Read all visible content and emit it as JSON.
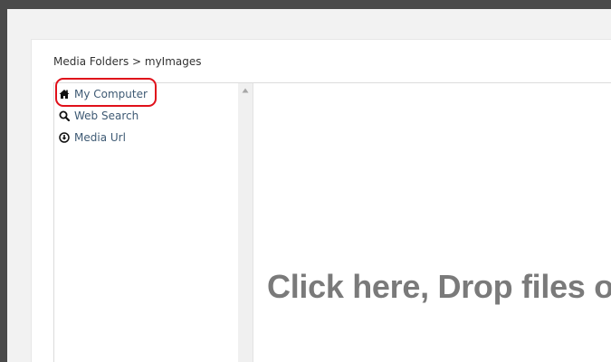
{
  "breadcrumb": {
    "text": "Media Folders > myImages"
  },
  "sources": [
    {
      "label": "My Computer",
      "icon": "home-icon",
      "selected": true
    },
    {
      "label": "Web Search",
      "icon": "search-icon"
    },
    {
      "label": "Media Url",
      "icon": "download-circle-icon"
    }
  ],
  "dropzone": {
    "text": "Click here, Drop files o"
  },
  "colors": {
    "link": "#3e5a74",
    "highlight": "#e0101a",
    "dropzone_text": "#7a7a7a"
  }
}
